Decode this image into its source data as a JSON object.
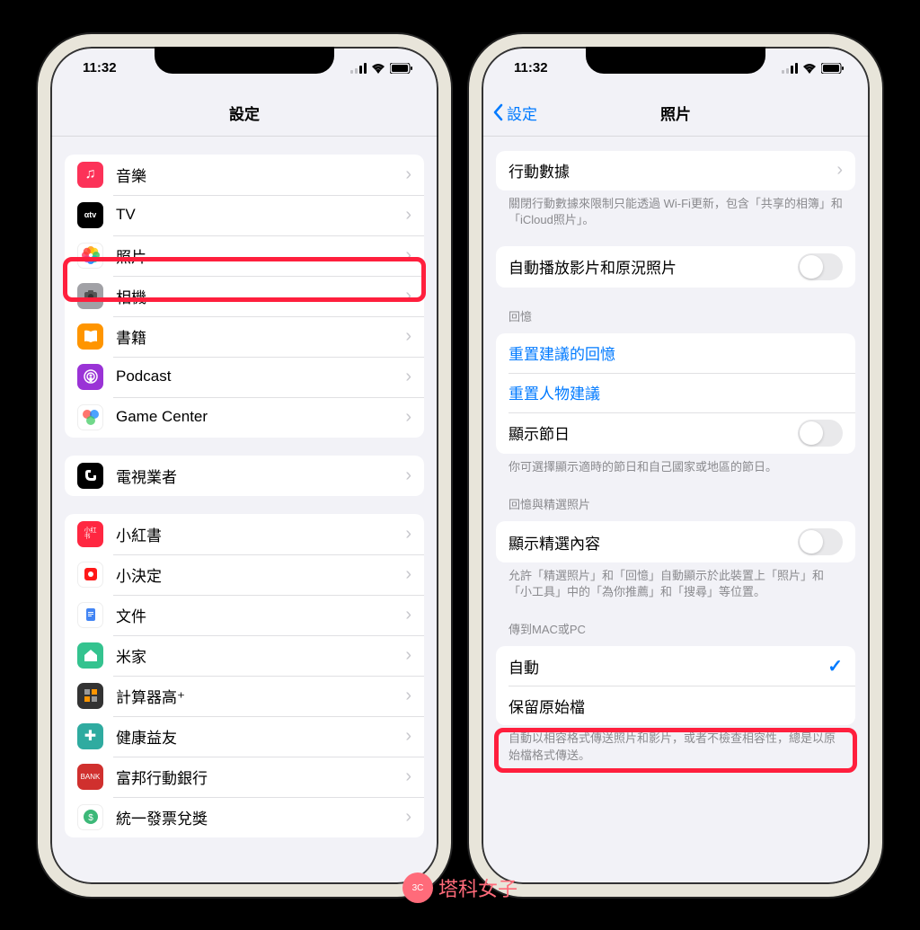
{
  "status": {
    "time": "11:32"
  },
  "left": {
    "title": "設定",
    "groups": [
      {
        "items": [
          {
            "label": "音樂",
            "icon_bg": "#fc3258",
            "icon_glyph": "♫"
          },
          {
            "label": "TV",
            "icon_bg": "#000",
            "icon_glyph": "tv"
          },
          {
            "label": "照片",
            "icon_bg": "#fff",
            "icon_glyph": "photos",
            "highlight": true
          },
          {
            "label": "相機",
            "icon_bg": "#a1a1a6",
            "icon_glyph": "cam"
          },
          {
            "label": "書籍",
            "icon_bg": "#ff9500",
            "icon_glyph": "book"
          },
          {
            "label": "Podcast",
            "icon_bg": "#9a33d6",
            "icon_glyph": "pod"
          },
          {
            "label": "Game Center",
            "icon_bg": "#fff",
            "icon_glyph": "gc"
          }
        ]
      },
      {
        "items": [
          {
            "label": "電視業者",
            "icon_bg": "#000",
            "icon_glyph": "cable"
          }
        ]
      },
      {
        "items": [
          {
            "label": "小紅書",
            "icon_bg": "#ff2741",
            "icon_glyph": "小红书"
          },
          {
            "label": "小決定",
            "icon_bg": "#fff",
            "icon_glyph": "dec"
          },
          {
            "label": "文件",
            "icon_bg": "#fff",
            "icon_glyph": "doc"
          },
          {
            "label": "米家",
            "icon_bg": "#34c38f",
            "icon_glyph": "mi"
          },
          {
            "label": "計算器高⁺",
            "icon_bg": "#333",
            "icon_glyph": "calc"
          },
          {
            "label": "健康益友",
            "icon_bg": "#2faba0",
            "icon_glyph": "health"
          },
          {
            "label": "富邦行動銀行",
            "icon_bg": "#d0302e",
            "icon_glyph": "bank"
          },
          {
            "label": "統一發票兌獎",
            "icon_bg": "#fff",
            "icon_glyph": "lot"
          }
        ]
      }
    ]
  },
  "right": {
    "back": "設定",
    "title": "照片",
    "cellular": {
      "label": "行動數據",
      "footer": "關閉行動數據來限制只能透過 Wi-Fi更新，包含「共享的相簿」和「iCloud照片」。"
    },
    "autoplay": {
      "label": "自動播放影片和原況照片"
    },
    "memories": {
      "header": "回憶",
      "reset_suggested": "重置建議的回憶",
      "reset_people": "重置人物建議",
      "show_holidays": "顯示節日",
      "footer": "你可選擇顯示適時的節日和自己國家或地區的節日。"
    },
    "featured": {
      "header": "回憶與精選照片",
      "show": "顯示精選內容",
      "footer": "允許「精選照片」和「回憶」自動顯示於此裝置上「照片」和「小工具」中的「為你推薦」和「搜尋」等位置。"
    },
    "transfer": {
      "header": "傳到MAC或PC",
      "auto": "自動",
      "keep": "保留原始檔",
      "footer": "自動以相容格式傳送照片和影片，或者不檢查相容性，總是以原始檔格式傳送。"
    }
  },
  "watermark": "塔科女子"
}
